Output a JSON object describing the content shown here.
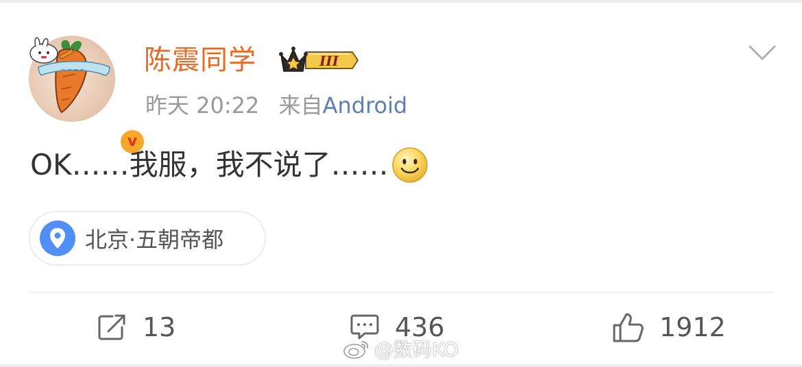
{
  "post": {
    "author": {
      "name": "陈震同学",
      "vip_level": "III"
    },
    "meta": {
      "time": "昨天 20:22",
      "source_prefix": "来自",
      "source": "Android"
    },
    "text": "OK……我服，我不说了……",
    "emoji": "smile-emoji",
    "location": "北京·五朝帝都",
    "actions": {
      "repost_count": "13",
      "comment_count": "436",
      "like_count": "1912"
    }
  },
  "watermark": "@数码KO",
  "colors": {
    "username": "#e86b21",
    "source_link": "#5a7fb5",
    "meta_gray": "#999999",
    "pin_blue": "#4f8ff7",
    "verified_gold": "#f7a82b"
  },
  "icons": [
    "chevron-down-icon",
    "verified-icon",
    "crown-icon",
    "location-pin-icon",
    "repost-icon",
    "comment-icon",
    "like-icon",
    "weibo-logo-icon"
  ]
}
